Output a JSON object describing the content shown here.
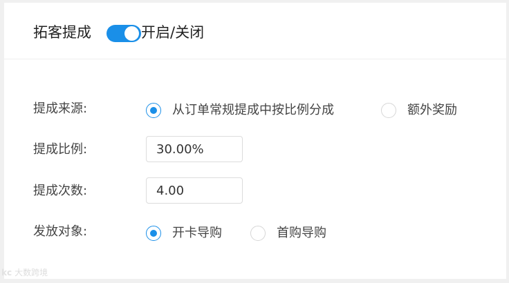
{
  "header": {
    "title": "拓客提成",
    "toggle_on": true,
    "toggle_text": "开启/关闭"
  },
  "form": {
    "source": {
      "label": "提成来源:",
      "options": [
        {
          "label": "从订单常规提成中按比例分成",
          "checked": true
        },
        {
          "label": "额外奖励",
          "checked": false
        }
      ]
    },
    "ratio": {
      "label": "提成比例:",
      "value": "30.00%"
    },
    "count": {
      "label": "提成次数:",
      "value": "4.00"
    },
    "target": {
      "label": "发放对象:",
      "options": [
        {
          "label": "开卡导购",
          "checked": true
        },
        {
          "label": "首购导购",
          "checked": false
        }
      ]
    }
  },
  "watermark": {
    "logo": "kc",
    "text": "大数跨境"
  },
  "colors": {
    "accent": "#1a8fe8",
    "border": "#dcdcdc",
    "text": "#444444"
  }
}
